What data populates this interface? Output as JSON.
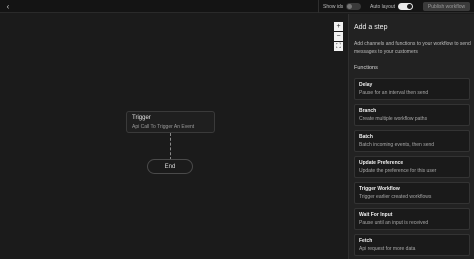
{
  "topbar": {
    "back_icon": "chevron-left-icon",
    "show_ids_label": "Show ids",
    "show_ids_on": false,
    "auto_layout_label": "Auto layout",
    "auto_layout_on": true,
    "publish_label": "Publish workflow"
  },
  "canvas": {
    "zoom_in": "+",
    "zoom_out": "−",
    "fit": "⛶",
    "trigger": {
      "title": "Trigger",
      "subtitle": "Api Call To Trigger An Event"
    },
    "end_label": "End"
  },
  "panel": {
    "title": "Add a step",
    "description": "Add channels and functions to your workflow to send messages to your customers",
    "section_label": "Functions",
    "steps": [
      {
        "title": "Delay",
        "desc": "Pause for an interval then send"
      },
      {
        "title": "Branch",
        "desc": "Create multiple workflow paths"
      },
      {
        "title": "Batch",
        "desc": "Batch incoming events, then send"
      },
      {
        "title": "Update Preference",
        "desc": "Update the preference for this user"
      },
      {
        "title": "Trigger Workflow",
        "desc": "Trigger earlier created workflows"
      },
      {
        "title": "Wait For Input",
        "desc": "Pause until an input is received"
      },
      {
        "title": "Fetch",
        "desc": "Api request for more data"
      }
    ]
  }
}
